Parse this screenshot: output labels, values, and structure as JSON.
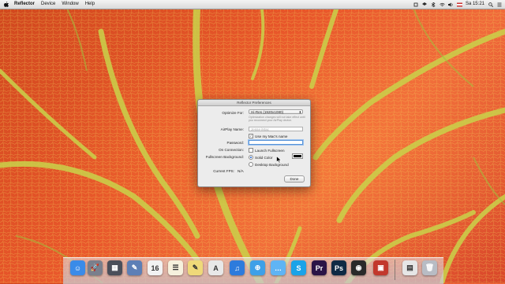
{
  "menubar": {
    "app": "Reflector",
    "menus": [
      "Device",
      "Window",
      "Help"
    ],
    "clock": "Sa 15:21"
  },
  "window": {
    "title": "Reflector Preferences",
    "optimize_label": "Optimize For:",
    "optimize_value": "Hi-Res (1920x1080)",
    "optimize_note": "Optimization changes will not take effect until you reconnect your AirPlay device.",
    "airplay_name_label": "AirPlay Name:",
    "airplay_name_placeholder": "Jesse iMac",
    "use_mac_name_label": "Use my Mac's name",
    "use_mac_name_checked": true,
    "password_label": "Password:",
    "password_value": "",
    "on_connection_label": "On Connection:",
    "launch_fullscreen_label": "Launch Fullscreen",
    "launch_fullscreen_checked": false,
    "fullscreen_bg_label": "Fullscreen Background:",
    "bg_options": [
      "Solid Color",
      "Desktop Background"
    ],
    "bg_selected": "Solid Color",
    "bg_color": "#000000",
    "fps_label": "Current FPS:",
    "fps_value": "N/A",
    "done_label": "Done"
  },
  "dock": {
    "items": [
      {
        "name": "finder-icon",
        "glyph": "☺",
        "color": "#3a8be8"
      },
      {
        "name": "launchpad-icon",
        "glyph": "🚀",
        "color": "#7a7f8c"
      },
      {
        "name": "mission-control-icon",
        "glyph": "▦",
        "color": "#4b4f5a"
      },
      {
        "name": "preview-icon",
        "glyph": "✎",
        "color": "#5d7fb6"
      },
      {
        "name": "calendar-icon",
        "glyph": "16",
        "color": "#f2f2f2"
      },
      {
        "name": "reminders-icon",
        "glyph": "☰",
        "color": "#f6f1dd"
      },
      {
        "name": "notes-icon",
        "glyph": "✎",
        "color": "#efd979"
      },
      {
        "name": "textedit-icon",
        "glyph": "A",
        "color": "#e8e8e8"
      },
      {
        "name": "itunes-icon",
        "glyph": "♫",
        "color": "#2d7bdc"
      },
      {
        "name": "safari-icon",
        "glyph": "⊕",
        "color": "#3ea0e8"
      },
      {
        "name": "messages-icon",
        "glyph": "…",
        "color": "#5fb4f4"
      },
      {
        "name": "skype-icon",
        "glyph": "S",
        "color": "#1aa3e8"
      },
      {
        "name": "premiere-icon",
        "glyph": "Pr",
        "color": "#2a1446"
      },
      {
        "name": "photoshop-icon",
        "glyph": "Ps",
        "color": "#0f2a44"
      },
      {
        "name": "camera-icon",
        "glyph": "◉",
        "color": "#2a2a2a"
      },
      {
        "name": "photo-booth-icon",
        "glyph": "▣",
        "color": "#c2382c"
      },
      {
        "name": "documents-icon",
        "glyph": "▤",
        "color": "#e6e6e6"
      },
      {
        "name": "trash-icon",
        "glyph": "🗑",
        "color": "#b8bcc4"
      }
    ]
  }
}
